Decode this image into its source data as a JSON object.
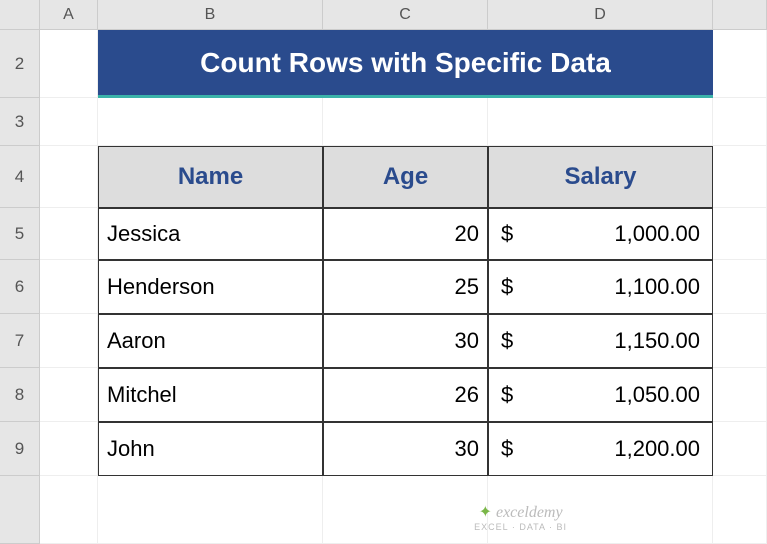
{
  "columns": [
    "",
    "A",
    "B",
    "C",
    "D",
    ""
  ],
  "rows": [
    "2",
    "3",
    "4",
    "5",
    "6",
    "7",
    "8",
    "9",
    ""
  ],
  "title": "Count Rows with Specific Data",
  "headers": {
    "name": "Name",
    "age": "Age",
    "salary": "Salary"
  },
  "data": [
    {
      "name": "Jessica",
      "age": "20",
      "salary": "1,000.00"
    },
    {
      "name": "Henderson",
      "age": "25",
      "salary": "1,100.00"
    },
    {
      "name": "Aaron",
      "age": "30",
      "salary": "1,150.00"
    },
    {
      "name": "Mitchel",
      "age": "26",
      "salary": "1,050.00"
    },
    {
      "name": "John",
      "age": "30",
      "salary": "1,200.00"
    }
  ],
  "currency": "$",
  "watermark": {
    "line1": "exceldemy",
    "line2": "EXCEL · DATA · BI"
  },
  "chart_data": {
    "type": "table",
    "title": "Count Rows with Specific Data",
    "columns": [
      "Name",
      "Age",
      "Salary"
    ],
    "rows": [
      [
        "Jessica",
        20,
        1000.0
      ],
      [
        "Henderson",
        25,
        1100.0
      ],
      [
        "Aaron",
        30,
        1150.0
      ],
      [
        "Mitchel",
        26,
        1050.0
      ],
      [
        "John",
        30,
        1200.0
      ]
    ]
  }
}
